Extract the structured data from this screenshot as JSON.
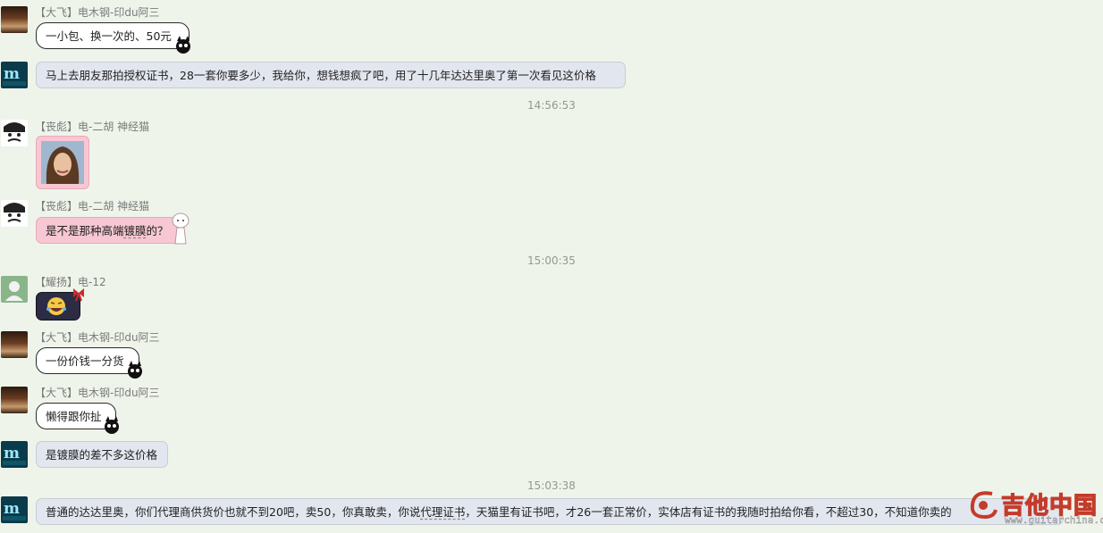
{
  "messages": [
    {
      "sender": "【大飞】电木钢-印du阿三",
      "text": "一小包、换一次的、50元"
    },
    {
      "text": "马上去朋友那拍授权证书，28一套你要多少，我给你，想钱想疯了吧，用了十几年达达里奥了第一次看见这价格"
    },
    {
      "sender": "【丧彪】电-二胡 神经猫"
    },
    {
      "sender": "【丧彪】电-二胡 神经猫",
      "text_pre": "是不是那种高端",
      "text_wavy": "镀膜",
      "text_post": "的？"
    },
    {
      "sender": "【耀扬】电-12"
    },
    {
      "sender": "【大飞】电木钢-印du阿三",
      "text": "一份价钱一分货"
    },
    {
      "sender": "【大飞】电木钢-印du阿三",
      "text": "懒得跟你扯"
    },
    {
      "text": "是镀膜的差不多这价格"
    },
    {
      "text_pre": "普通的达达里奥，你们代理商供货价也就不到20吧，卖50，你真敢卖，你说",
      "text_wavy": "代理证书",
      "text_post": "，天猫里有证书吧，才26一套正常价，实体店有证书的我随时拍给你看，不超过30，不知道你卖的"
    }
  ],
  "timestamps": [
    "14:56:53",
    "15:00:35",
    "15:03:38"
  ],
  "watermark": {
    "brand": "吉他中国",
    "url": "www.guitarchina.com"
  },
  "colors": {
    "background": "#eff4ea",
    "grey_bubble": "#e2e6ee",
    "pink_bubble": "#f7c7d3",
    "name_text": "#7a7a7a",
    "timestamp": "#8f9a8f"
  }
}
